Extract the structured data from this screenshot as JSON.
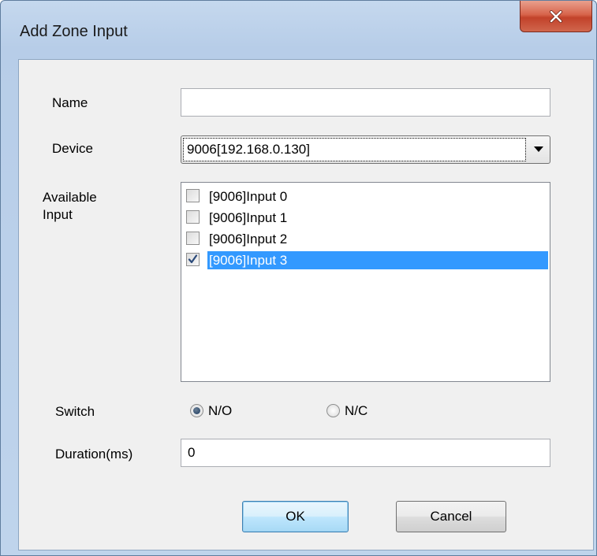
{
  "window": {
    "title": "Add Zone Input",
    "close_icon": "close-icon"
  },
  "form": {
    "name_label": "Name",
    "name_value": "",
    "device_label": "Device",
    "device_value": "9006[192.168.0.130]",
    "available_label_line1": "Available",
    "available_label_line2": "Input",
    "inputs": [
      {
        "label": "[9006]Input 0",
        "checked": false,
        "selected": false
      },
      {
        "label": "[9006]Input 1",
        "checked": false,
        "selected": false
      },
      {
        "label": "[9006]Input 2",
        "checked": false,
        "selected": false
      },
      {
        "label": "[9006]Input 3",
        "checked": true,
        "selected": true
      }
    ],
    "switch_label": "Switch",
    "switch_options": [
      {
        "label": "N/O",
        "selected": true
      },
      {
        "label": "N/C",
        "selected": false
      }
    ],
    "duration_label": "Duration(ms)",
    "duration_value": "0"
  },
  "buttons": {
    "ok": "OK",
    "cancel": "Cancel"
  },
  "colors": {
    "selection": "#3399ff",
    "frame": "#bfd4ec",
    "close": "#c2422a"
  }
}
